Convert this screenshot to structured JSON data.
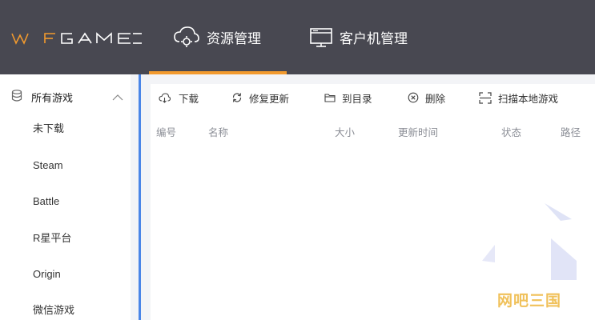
{
  "app": {
    "logo_text": "WFGAME",
    "colors": {
      "topbar": "#484851",
      "accent": "#f29a2e",
      "sidebar_accent": "#4a86e8",
      "background": "#f3f4f7"
    }
  },
  "top_tabs": [
    {
      "label": "资源管理",
      "icon": "cloud-settings-icon",
      "active": true
    },
    {
      "label": "客户机管理",
      "icon": "monitor-icon",
      "active": false
    }
  ],
  "sidebar": {
    "group": {
      "label": "所有游戏",
      "icon": "database-icon",
      "expanded": true
    },
    "items": [
      {
        "label": "未下载"
      },
      {
        "label": "Steam"
      },
      {
        "label": "Battle"
      },
      {
        "label": "R星平台"
      },
      {
        "label": "Origin"
      },
      {
        "label": "微信游戏"
      }
    ]
  },
  "toolbar": {
    "buttons": [
      {
        "label": "下载",
        "icon": "cloud-download-icon"
      },
      {
        "label": "修复更新",
        "icon": "refresh-icon"
      },
      {
        "label": "到目录",
        "icon": "folder-icon"
      },
      {
        "label": "删除",
        "icon": "delete-circle-icon"
      },
      {
        "label": "扫描本地游戏",
        "icon": "scan-icon"
      }
    ]
  },
  "table": {
    "columns": [
      "编号",
      "名称",
      "大小",
      "更新时间",
      "状态",
      "路径"
    ],
    "rows": []
  },
  "watermark": {
    "text": "网吧三国"
  }
}
